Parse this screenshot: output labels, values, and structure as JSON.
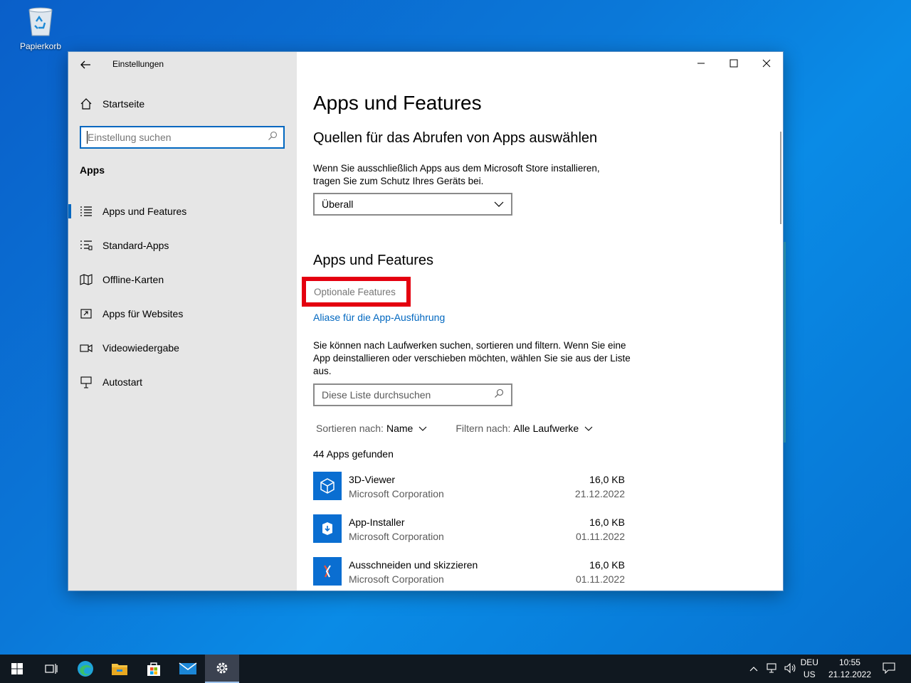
{
  "desktop": {
    "recycle_bin_label": "Papierkorb"
  },
  "window": {
    "title": "Einstellungen",
    "controls": {
      "minimize": "minimize",
      "maximize": "maximize",
      "close": "close"
    }
  },
  "sidebar": {
    "home_label": "Startseite",
    "search_placeholder": "Einstellung suchen",
    "section_title": "Apps",
    "items": [
      {
        "label": "Apps und Features",
        "icon": "list-icon",
        "active": true
      },
      {
        "label": "Standard-Apps",
        "icon": "default-apps-icon",
        "active": false
      },
      {
        "label": "Offline-Karten",
        "icon": "map-icon",
        "active": false
      },
      {
        "label": "Apps für Websites",
        "icon": "website-apps-icon",
        "active": false
      },
      {
        "label": "Videowiedergabe",
        "icon": "video-icon",
        "active": false
      },
      {
        "label": "Autostart",
        "icon": "startup-icon",
        "active": false
      }
    ]
  },
  "main": {
    "page_title": "Apps und Features",
    "sources_heading": "Quellen für das Abrufen von Apps auswählen",
    "sources_text": "Wenn Sie ausschließlich Apps aus dem Microsoft Store installieren, tragen Sie zum Schutz Ihres Geräts bei.",
    "sources_dropdown_value": "Überall",
    "apps_heading": "Apps und Features",
    "optional_features_link": "Optionale Features",
    "alias_link": "Aliase für die App-Ausführung",
    "search_text": "Sie können nach Laufwerken suchen, sortieren und filtern. Wenn Sie eine App deinstallieren oder verschieben möchten, wählen Sie sie aus der Liste aus.",
    "list_search_placeholder": "Diese Liste durchsuchen",
    "sort_label": "Sortieren nach:",
    "sort_value": "Name",
    "filter_label": "Filtern nach:",
    "filter_value": "Alle Laufwerke",
    "apps_count": "44 Apps gefunden",
    "apps": [
      {
        "name": "3D-Viewer",
        "publisher": "Microsoft Corporation",
        "size": "16,0 KB",
        "date": "21.12.2022",
        "icon": "3d-viewer-icon"
      },
      {
        "name": "App-Installer",
        "publisher": "Microsoft Corporation",
        "size": "16,0 KB",
        "date": "01.11.2022",
        "icon": "app-installer-icon"
      },
      {
        "name": "Ausschneiden und skizzieren",
        "publisher": "Microsoft Corporation",
        "size": "16,0 KB",
        "date": "01.11.2022",
        "icon": "snip-sketch-icon"
      }
    ]
  },
  "taskbar": {
    "apps": [
      "start-icon",
      "task-view-icon",
      "edge-icon",
      "file-explorer-icon",
      "store-icon",
      "mail-icon",
      "settings-icon"
    ],
    "language_top": "DEU",
    "language_bottom": "US",
    "time": "10:55",
    "date": "21.12.2022"
  },
  "colors": {
    "accent": "#0067c0",
    "highlight_box": "#e4000f",
    "app_tile": "#0a6ed1",
    "taskbar": "#101820"
  }
}
